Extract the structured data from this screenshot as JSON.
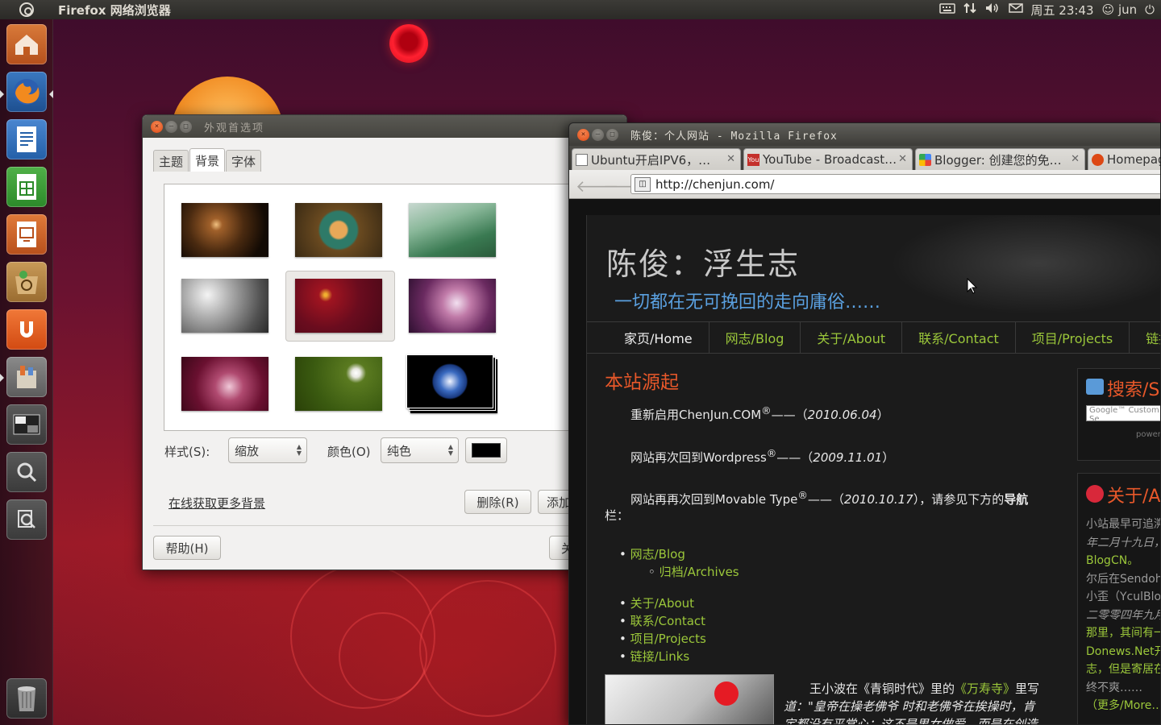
{
  "top_panel": {
    "app_title": "Firefox 网络浏览器",
    "clock": "周五 23:43",
    "user": "jun"
  },
  "launcher": {
    "items": [
      "home-folder",
      "firefox",
      "writer",
      "calc",
      "impress",
      "software-center",
      "ubuntu-one",
      "settings",
      "workspace-switcher",
      "dash-search",
      "dash-apps",
      "trash"
    ]
  },
  "appearance_dialog": {
    "title": "外观首选项",
    "tabs": [
      "主题",
      "背景",
      "字体"
    ],
    "active_tab": "背景",
    "style_label": "样式(S):",
    "style_value": "缩放",
    "color_label": "颜色(O)",
    "color_value": "纯色",
    "color_swatch": "#000000",
    "more_backgrounds_link": "在线获取更多背景",
    "delete_button": "删除(R)",
    "add_button": "添加",
    "help_button": "帮助(H)",
    "close_button": "关"
  },
  "firefox": {
    "title": "陈俊：个人网站 - Mozilla Firefox",
    "tabs": [
      {
        "label": "Ubuntu开启IPV6，…"
      },
      {
        "label": "YouTube - Broadcast…"
      },
      {
        "label": "Blogger: 创建您的免…"
      },
      {
        "label": "Homepag"
      }
    ],
    "url": "http://chenjun.com/",
    "site": {
      "title": "陈俊：浮生志",
      "subtitle": "一切都在无可挽回的走向庸俗……",
      "nav": [
        "家页/Home",
        "网志/Blog",
        "关于/About",
        "联系/Contact",
        "项目/Projects",
        "链接"
      ],
      "section_title": "本站源起",
      "lines": [
        {
          "text": "重新启用ChenJun.COM",
          "sup": "®",
          "dash": "——（",
          "date": "2010.06.04",
          "end": "）"
        },
        {
          "text": "网站再次回到Wordpress",
          "sup": "®",
          "dash": "——（",
          "date": "2009.11.01",
          "end": "）"
        },
        {
          "text": "网站再再次回到Movable Type",
          "sup": "®",
          "dash": "——（",
          "date": "2010.10.17",
          "end": "），请参见下方的"
        }
      ],
      "nav_bold": "导航",
      "nav_suffix": "栏：",
      "list_blog": "网志/Blog",
      "list_archives": "归档/Archives",
      "list_items": [
        "关于/About",
        "联系/Contact",
        "项目/Projects",
        "链接/Links"
      ],
      "quote_line1_a": "王小波在《青铜时代》里的",
      "quote_line1_link": "《万寿寺》",
      "quote_line1_b": "里写",
      "quote_line2": "道：\"皇帝在操老佛爷 时和老佛爷在挨操时，肯",
      "quote_line3": "定都没有平常心；这不是男女做爱，而是在创造",
      "search_title": "搜索/S",
      "search_powered": "power",
      "about_title": "关于/A",
      "about_lines": [
        "小站最早可追溯",
        "年二月十九日，",
        "BlogCN。",
        "尔后在Sendoh",
        "小歪（YculBlo",
        "二零零四年九月",
        "那里，其间有一",
        "Donews.Net开",
        "志，但是寄居在",
        "终不爽……",
        "（更多/More…"
      ]
    }
  }
}
